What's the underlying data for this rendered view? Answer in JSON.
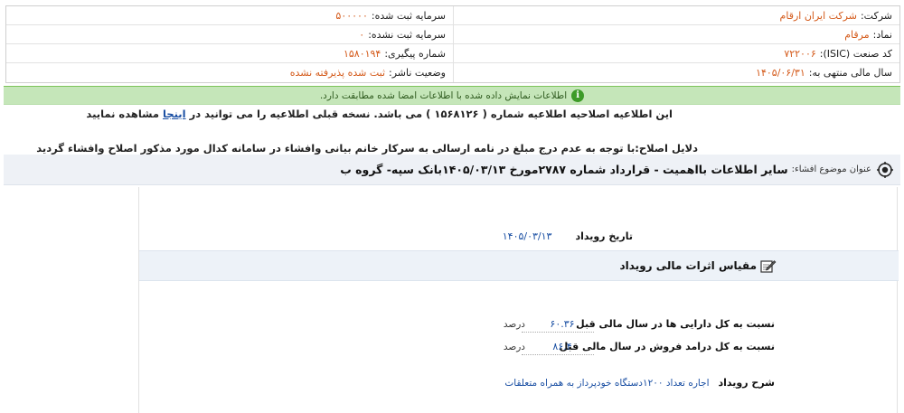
{
  "info": {
    "company_label": "شرکت:",
    "company_value": "شرکت ایران ارقام",
    "reg_capital_label": "سرمایه ثبت شده:",
    "reg_capital_value": "۵۰۰۰۰۰",
    "symbol_label": "نماد:",
    "symbol_value": "مرقام",
    "unreg_capital_label": "سرمایه ثبت نشده:",
    "unreg_capital_value": "۰",
    "isic_label": "کد صنعت (ISIC):",
    "isic_value": "۷۲۲۰۰۶",
    "tracking_label": "شماره پیگیری:",
    "tracking_value": "۱۵۸۰۱۹۴",
    "fiscal_label": "سال مالی منتهی به:",
    "fiscal_value": "۱۴۰۵/۰۶/۳۱",
    "publisher_status_label": "وضعیت ناشر:",
    "publisher_status_value": "ثبت شده پذیرفته نشده"
  },
  "banner": {
    "icon": "info-icon",
    "text": "اطلاعات نمایش داده شده با اطلاعات امضا شده مطابقت دارد."
  },
  "notice": {
    "line1_before": "این اطلاعیه اصلاحیه اطلاعیه شماره ( ۱۵۶۸۱۲۶ ) می باشد. نسخه قبلی اطلاعیه را می توانید در",
    "line1_link": "اینجا",
    "line1_after": "مشاهده نمایید",
    "line2": "دلایل اصلاح:با توجه به عدم درج مبلغ در نامه ارسالی به سرکار خانم بیانی وافشاء در سامانه کدال مورد مذکور اصلاح وافشاء گردید"
  },
  "subject": {
    "label": "عنوان موضوع افشاء:",
    "text": "سایر اطلاعات بااهمیت - قرارداد شماره ۲۷۸۷مورخ ۱۴۰۵/۰۳/۱۳بانک سپه- گروه ب"
  },
  "event": {
    "date_label": "تاریخ رویداد",
    "date_value": "۱۴۰۵/۰۳/۱۳",
    "section_title": "مقیاس اثرات مالی رویداد",
    "metrics": [
      {
        "label": "نسبت به کل دارایی ها در سال مالی قبل",
        "value": "۶۰.۳۶",
        "unit": "درصد"
      },
      {
        "label": "نسبت به کل درامد فروش در سال مالی قبل",
        "value": "۸۶.۴",
        "unit": "درصد"
      }
    ],
    "desc_label": "شرح رویداد",
    "desc_value": "اجاره تعداد ۱۲۰۰دستگاه خودپرداز به همراه متعلقات"
  }
}
